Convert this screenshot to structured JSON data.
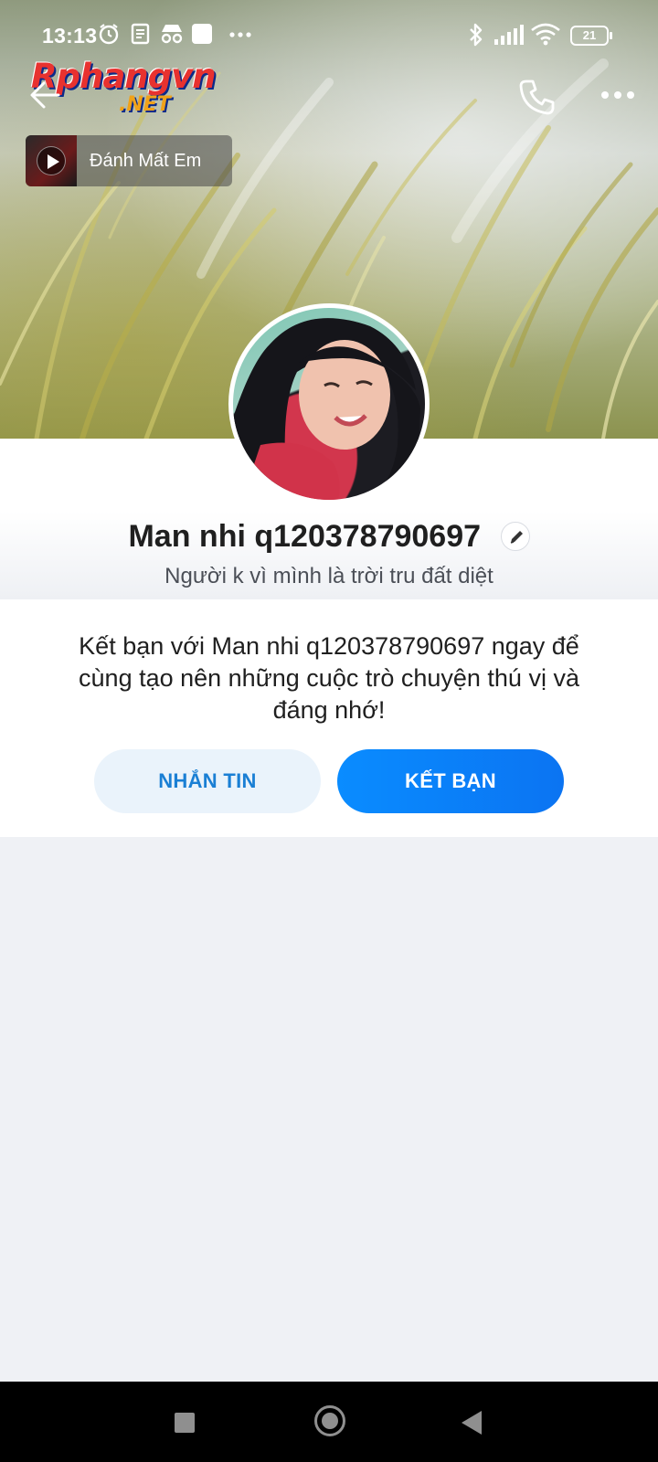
{
  "status_bar": {
    "time": "13:13",
    "battery": "21",
    "left_icons": [
      "alarm-icon",
      "news-icon",
      "incognito-icon",
      "app-icon",
      "more-dots-icon"
    ],
    "right_icons": [
      "bluetooth-icon",
      "signal-icon",
      "wifi-icon",
      "battery-icon"
    ]
  },
  "watermark": {
    "top": "Rphangvn",
    "bottom": ".NET"
  },
  "header": {
    "back_icon": "back-arrow-icon",
    "call_icon": "phone-icon",
    "more_icon": "more-horizontal-icon"
  },
  "music": {
    "title": "Đánh Mất Em",
    "icon": "play-icon"
  },
  "profile": {
    "name": "Man nhi q120378790697",
    "status": "Người k vì mình là trời tru đất diệt",
    "edit_icon": "pencil-icon"
  },
  "friend_prompt": {
    "message": "Kết bạn với Man nhi q120378790697 ngay để cùng tạo nên những cuộc trò chuyện thú vị và đáng nhớ!",
    "message_button": "NHẮN TIN",
    "add_friend_button": "KẾT BẠN"
  },
  "colors": {
    "accent": "#0a8cff",
    "secondary_button_bg": "#eaf3fb",
    "secondary_button_text": "#1a7fd4",
    "page_bg": "#eff1f5"
  }
}
